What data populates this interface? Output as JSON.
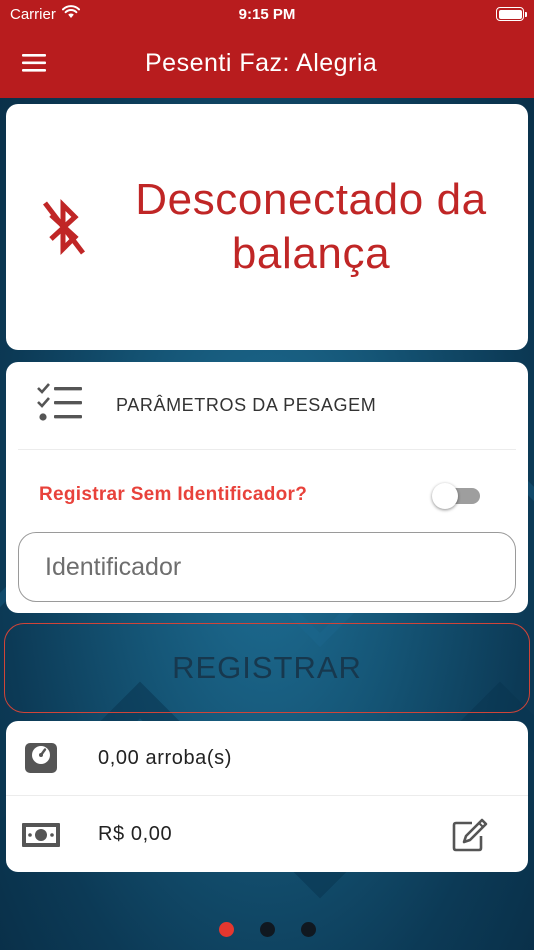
{
  "status_bar": {
    "carrier": "Carrier",
    "time": "9:15 PM"
  },
  "app_bar": {
    "title": "Pesenti Faz: Alegria",
    "menu_icon": "hamburger-menu-icon"
  },
  "connection": {
    "icon": "bluetooth-disabled-icon",
    "status_line1": "Desconectado da",
    "status_line2": "balança",
    "color": "#c02626"
  },
  "params": {
    "icon": "checklist-icon",
    "title": "PARÂMETROS DA PESAGEM",
    "toggle_label": "Registrar Sem Identificador?",
    "toggle_on": false,
    "identifier_placeholder": "Identificador",
    "identifier_value": ""
  },
  "register": {
    "label": "REGISTRAR"
  },
  "values": {
    "weight_icon": "scale-icon",
    "weight_text": "0,00 arroba(s)",
    "money_icon": "money-icon",
    "money_text": "R$ 0,00",
    "edit_icon": "edit-icon"
  },
  "pager": {
    "pages": 3,
    "active_index": 0
  },
  "colors": {
    "primary": "#b81c1e",
    "accent": "#e8423b",
    "background": "#155677"
  }
}
